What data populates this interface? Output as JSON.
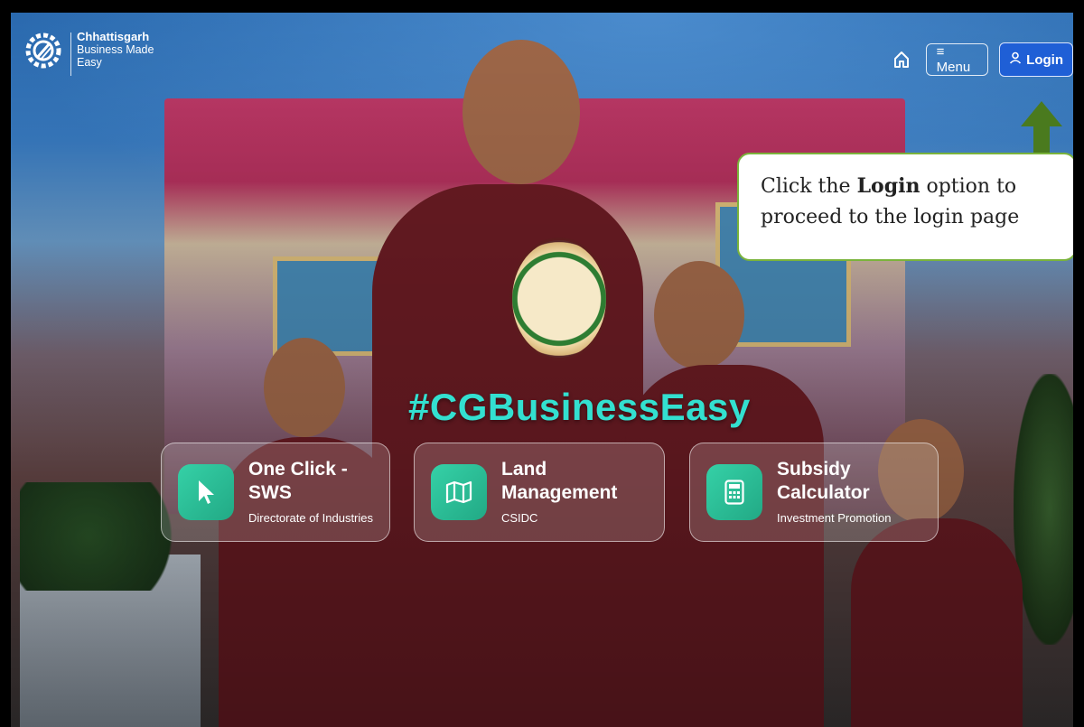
{
  "brand": {
    "title": "Chhattisgarh",
    "tagline_line1": "Business Made",
    "tagline_line2": "Easy",
    "logo_icon": "gear-shield-icon"
  },
  "nav": {
    "home_icon": "home-icon",
    "menu_label": "≡ Menu",
    "login_label": "Login",
    "login_icon": "user-icon",
    "login_color": "#1f5fd6"
  },
  "callout": {
    "text_before": "Click the ",
    "text_bold": "Login",
    "text_after": " option to proceed to the login page",
    "border_color": "#7ab33b",
    "arrow_color": "#4a7a1e"
  },
  "hero": {
    "hashtag": "#CGBusinessEasy",
    "hashtag_color": "#33e0d0"
  },
  "cards": [
    {
      "title": "One Click - SWS",
      "subtitle": "Directorate of Industries",
      "icon": "cursor-icon"
    },
    {
      "title": "Land Management",
      "subtitle": "CSIDC",
      "icon": "map-icon"
    },
    {
      "title": "Subsidy Calculator",
      "subtitle": "Investment Promotion",
      "icon": "calculator-icon"
    }
  ]
}
